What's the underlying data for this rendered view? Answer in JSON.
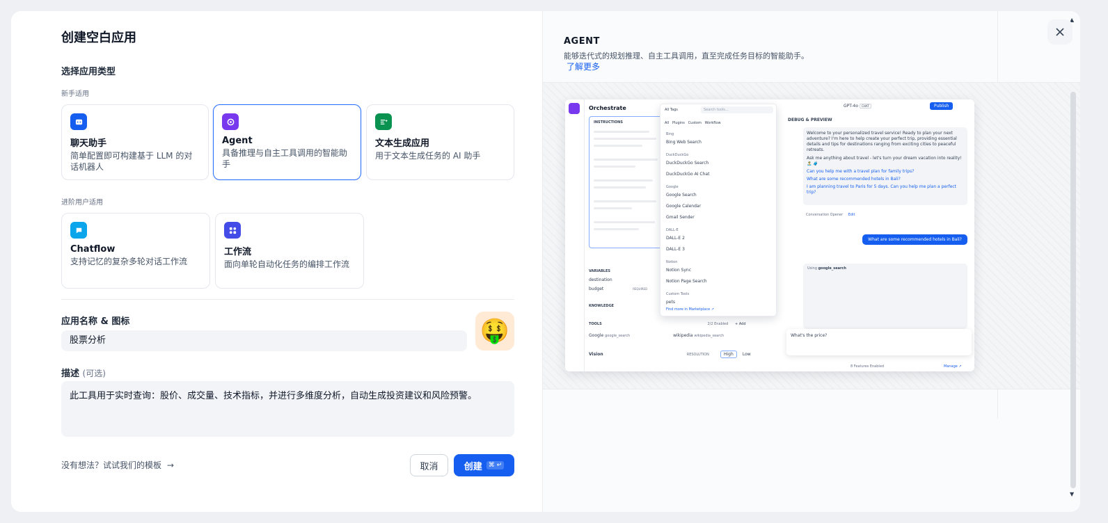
{
  "left": {
    "title": "创建空白应用",
    "type_section_title": "选择应用类型",
    "beginner_label": "新手适用",
    "advanced_label": "进阶用户适用",
    "cards_beginner": [
      {
        "name": "聊天助手",
        "desc": "简单配置即可构建基于 LLM 的对话机器人",
        "icon": "chat-bot-icon",
        "color": "#155eef"
      },
      {
        "name": "Agent",
        "desc": "具备推理与自主工具调用的智能助手",
        "icon": "agent-icon",
        "color": "#7839ee"
      },
      {
        "name": "文本生成应用",
        "desc": "用于文本生成任务的 AI 助手",
        "icon": "text-generation-icon",
        "color": "#099250"
      }
    ],
    "cards_advanced": [
      {
        "name": "Chatflow",
        "desc": "支持记忆的复杂多轮对话工作流",
        "icon": "chatflow-icon",
        "color": "#0ba5ec"
      },
      {
        "name": "工作流",
        "desc": "面向单轮自动化任务的编排工作流",
        "icon": "workflow-icon",
        "color": "#444ce7"
      }
    ],
    "name_section_title": "应用名称 & 图标",
    "name_value": "股票分析",
    "app_emoji": "🤑",
    "desc_section_title": "描述",
    "desc_optional": "(可选)",
    "desc_value": "此工具用于实时查询：股价、成交量、技术指标，并进行多维度分析，自动生成投资建议和风险预警。",
    "template_link": "没有想法？试试我们的模板",
    "cancel_label": "取消",
    "create_label": "创建",
    "create_shortcut": "⌘ ↵"
  },
  "right": {
    "agent_title": "AGENT",
    "agent_desc": "能够迭代式的规划推理、自主工具调用，直至完成任务目标的智能助手。",
    "learn_more": "了解更多",
    "preview": {
      "header": "Orchestrate",
      "instructions_label": "INSTRUCTIONS",
      "model": "GPT-4o",
      "model_tag": "CHAT",
      "publish": "Publish",
      "debug_title": "DEBUG & PREVIEW",
      "filter_label": "All Tags",
      "search_placeholder": "Search tools...",
      "tabs": [
        "All",
        "Plugins",
        "Custom",
        "Workflow"
      ],
      "tool_groups": [
        {
          "group": "Bing",
          "items": [
            "Bing Web Search"
          ]
        },
        {
          "group": "DuckDuckGo",
          "items": [
            "DuckDuckGo Search",
            "DuckDuckGo AI Chat"
          ]
        },
        {
          "group": "Google",
          "items": [
            "Google Search",
            "Google Calendar",
            "Gmail Sender"
          ]
        },
        {
          "group": "DALL-E",
          "items": [
            "DALL-E 2",
            "DALL-E 3"
          ]
        },
        {
          "group": "Notion",
          "items": [
            "Notion Sync",
            "Notion Page Search"
          ]
        },
        {
          "group": "Custom Tools",
          "items": [
            "pets"
          ]
        }
      ],
      "marketplace_link": "Find more in  Marketplace ↗",
      "variables_label": "VARIABLES",
      "variables": [
        "destination",
        "budget"
      ],
      "required_tag": "REQUIRED",
      "knowledge_label": "KNOWLEDGE",
      "tools_label": "TOOLS",
      "tools_enabled": "2/2 Enabled",
      "add_label": "+ Add",
      "tools": [
        {
          "name": "Google",
          "id": "google_search"
        },
        {
          "name": "wikipedia",
          "id": "wikipedia_search"
        }
      ],
      "vision_label": "Vision",
      "resolution_label": "RESOLUTION",
      "res_high": "High",
      "res_low": "Low",
      "welcome": "Welcome to your personalized travel service! Ready to plan your next adventure? I'm here to help create your perfect trip, providing essential details and tips for destinations ranging from exciting cities to peaceful retreats.",
      "ask_line": "Ask me anything about travel - let's turn your dream vacation into reality! 🏝️ 🧳",
      "suggestions": [
        "Can you help me with a travel plan for family trips?",
        "What are some recommended hotels in Bali?",
        "I am planning travel to Paris for 5 days. Can you help me plan a perfect trip?"
      ],
      "opener_label": "Conversation Opener",
      "edit_label": "Edit",
      "user_msg": "What are some recommended hotels in Bali?",
      "using_label": "Using",
      "using_tool": "google_search",
      "input_text": "What's the price?",
      "features": "8 Features Enabled",
      "manage": "Manage ↗"
    }
  }
}
